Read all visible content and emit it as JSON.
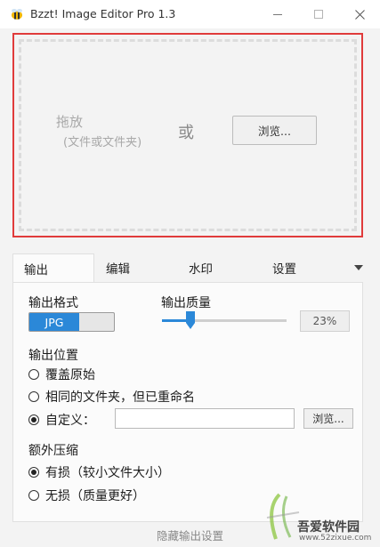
{
  "window": {
    "title": "Bzzt! Image Editor Pro 1.3"
  },
  "drop_area": {
    "label": "拖放",
    "sublabel": "(文件或文件夹)",
    "or_text": "或",
    "browse_label": "浏览..."
  },
  "tabs": [
    {
      "label": "输出",
      "active": true
    },
    {
      "label": "编辑",
      "active": false
    },
    {
      "label": "水印",
      "active": false
    },
    {
      "label": "设置",
      "active": false
    }
  ],
  "output": {
    "format_label": "输出格式",
    "format_value": "JPG",
    "quality_label": "输出质量",
    "quality_value": 23,
    "quality_text": "23%",
    "location_label": "输出位置",
    "location_options": [
      {
        "label": "覆盖原始",
        "checked": false
      },
      {
        "label": "相同的文件夹，但已重命名",
        "checked": false
      },
      {
        "label": "自定义：",
        "checked": true
      }
    ],
    "custom_path": "",
    "browse_label": "浏览...",
    "compression_label": "额外压缩",
    "compression_options": [
      {
        "label": "有损（较小文件大小）",
        "checked": true
      },
      {
        "label": "无损（质量更好）",
        "checked": false
      }
    ]
  },
  "footer": {
    "hide_settings": "隐藏输出设置"
  },
  "watermark": {
    "brand": "吾爱软件园",
    "url": "www.52zixue.com"
  },
  "colors": {
    "accent": "#2b88d8",
    "highlight_border": "#e03b3b"
  }
}
